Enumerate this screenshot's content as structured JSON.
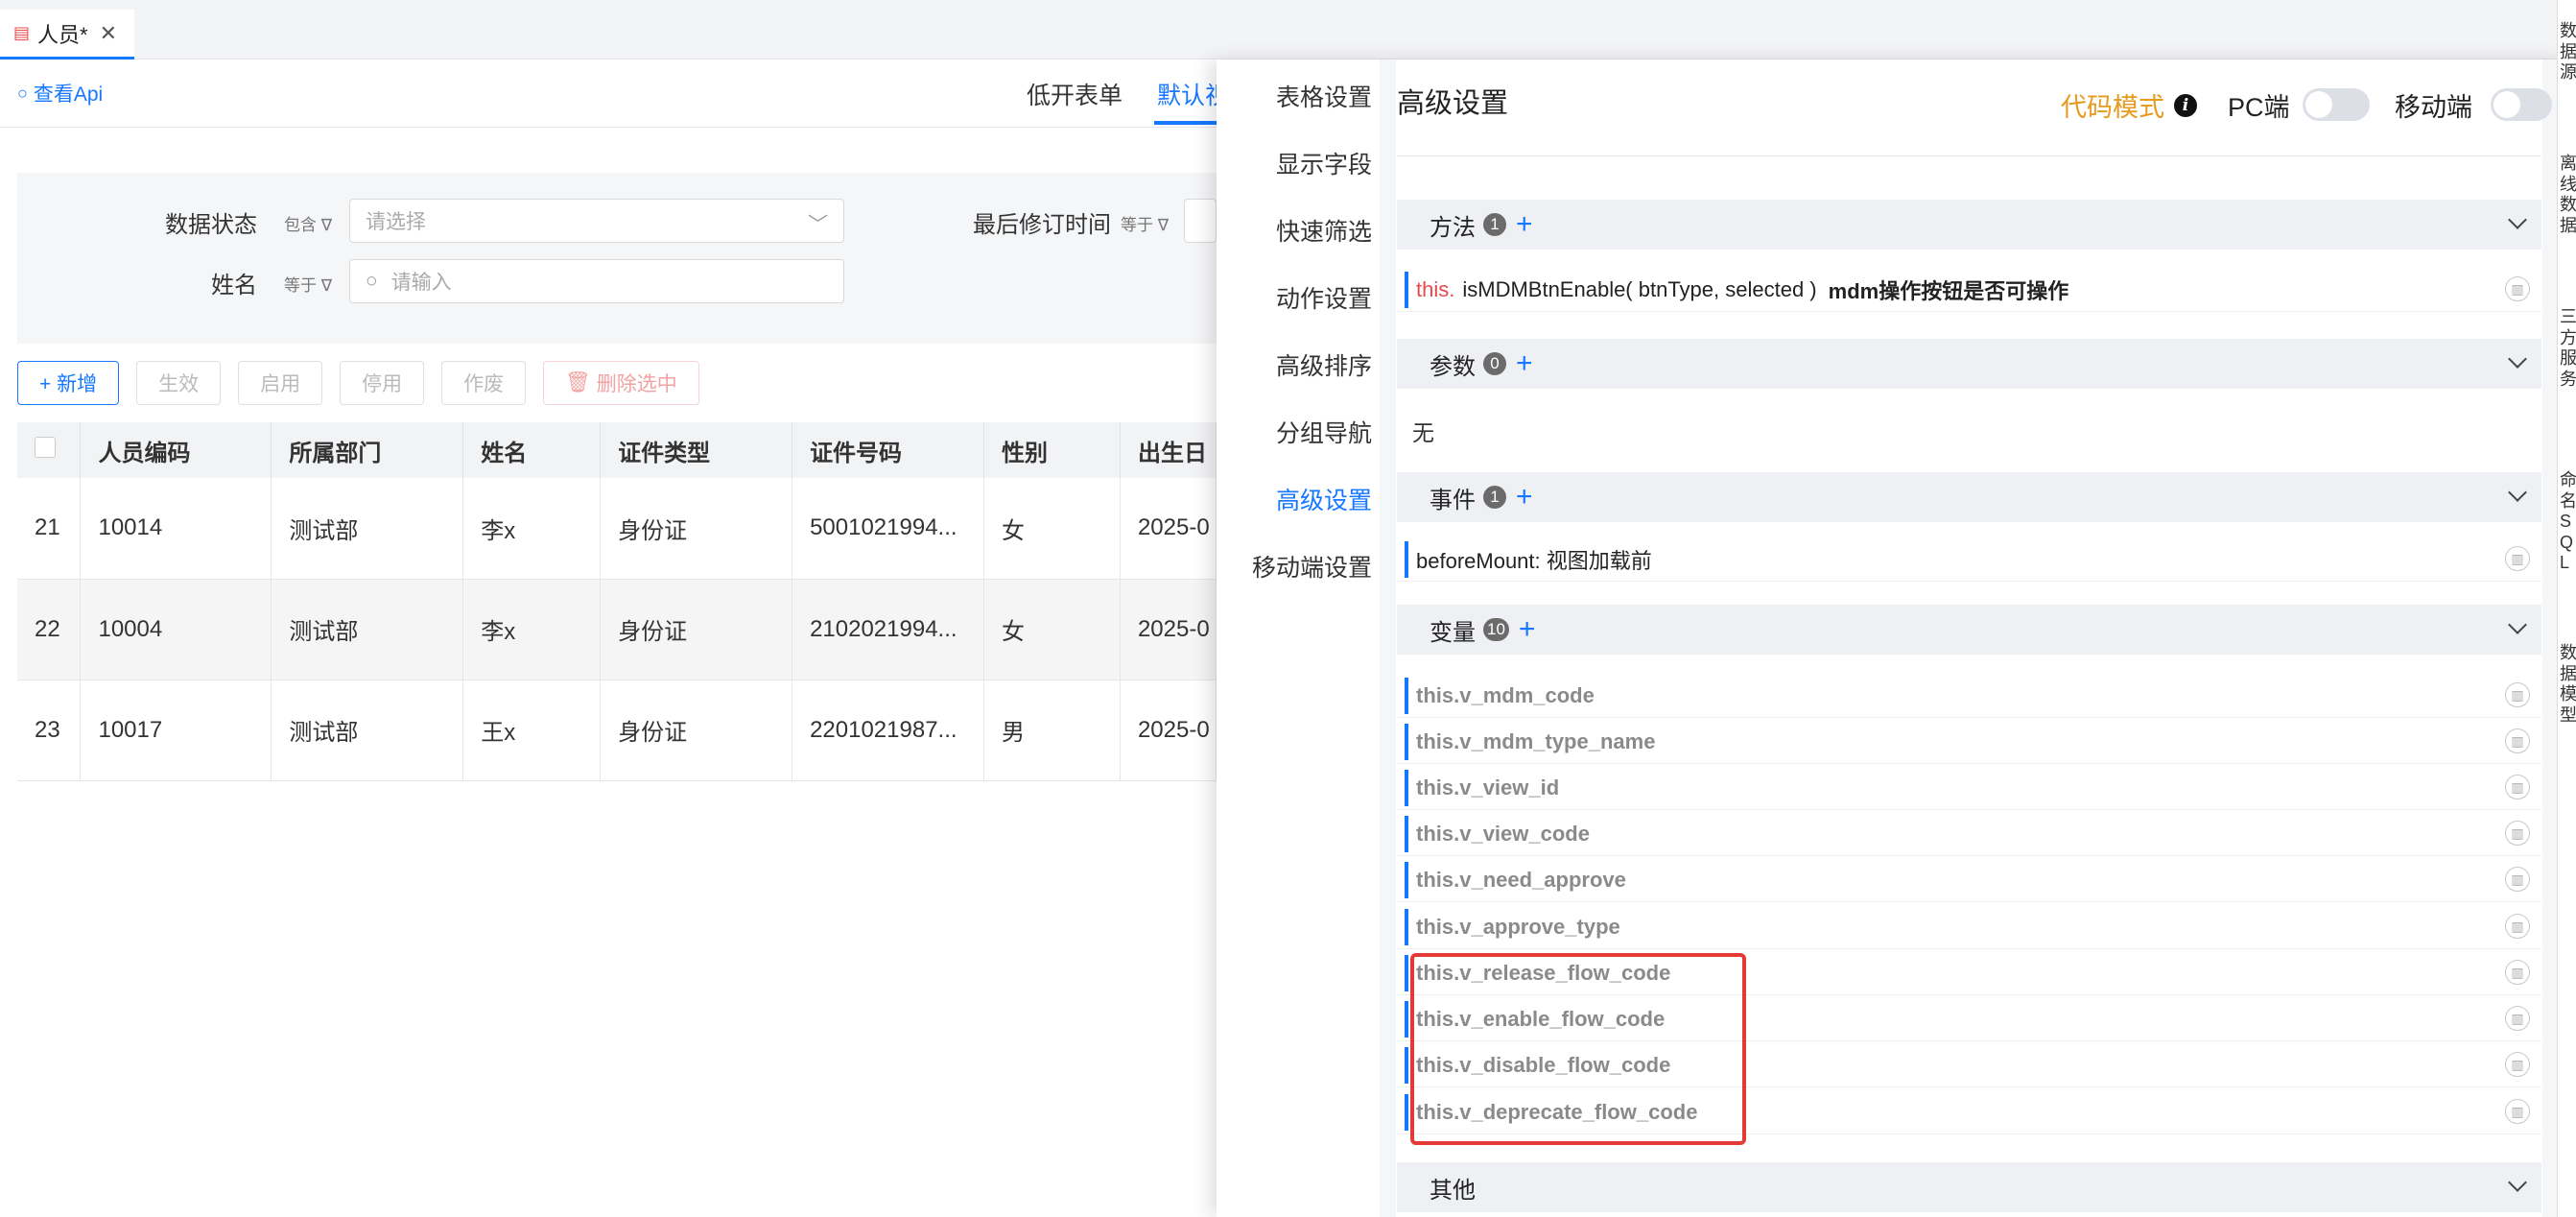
{
  "tab": {
    "title": "人员*",
    "doc_icon": "document-icon",
    "close_glyph": "✕"
  },
  "page": {
    "api_link": "查看Api",
    "nav": [
      "低开表单",
      "默认视"
    ]
  },
  "filters": {
    "status_label": "数据状态",
    "status_op": "包含",
    "status_placeholder": "请选择",
    "revise_label": "最后修订时间",
    "revise_op": "等于",
    "name_label": "姓名",
    "name_op": "等于",
    "name_placeholder": "请输入"
  },
  "toolbar": {
    "add": "+ 新增",
    "effect": "生效",
    "enable": "启用",
    "disable": "停用",
    "void": "作废",
    "delete": "删除选中"
  },
  "table": {
    "headers": [
      "人员编码",
      "所属部门",
      "姓名",
      "证件类型",
      "证件号码",
      "性别",
      "出生日"
    ],
    "rows": [
      [
        "21",
        "10014",
        "测试部",
        "李x",
        "身份证",
        "5001021994...",
        "女",
        "2025-0"
      ],
      [
        "22",
        "10004",
        "测试部",
        "李x",
        "身份证",
        "2102021994...",
        "女",
        "2025-0"
      ],
      [
        "23",
        "10017",
        "测试部",
        "王x",
        "身份证",
        "2201021987...",
        "男",
        "2025-0"
      ]
    ]
  },
  "panel": {
    "menu": [
      "表格设置",
      "显示字段",
      "快速筛选",
      "动作设置",
      "高级排序",
      "分组导航",
      "高级设置",
      "移动端设置"
    ],
    "active_menu": "高级设置",
    "title": "高级设置",
    "code_mode": "代码模式",
    "pc_label": "PC端",
    "mobile_label": "移动端",
    "methods": {
      "label": "方法",
      "count": "1",
      "items": [
        {
          "kw": "this.",
          "sig": "isMDMBtnEnable( btnType, selected )",
          "desc": "mdm操作按钮是否可操作"
        }
      ]
    },
    "params": {
      "label": "参数",
      "count": "0",
      "empty": "无"
    },
    "events": {
      "label": "事件",
      "count": "1",
      "items": [
        "beforeMount: 视图加载前"
      ]
    },
    "variables": {
      "label": "变量",
      "count": "10",
      "items": [
        "this.v_mdm_code",
        "this.v_mdm_type_name",
        "this.v_view_id",
        "this.v_view_code",
        "this.v_need_approve",
        "this.v_approve_type",
        "this.v_release_flow_code",
        "this.v_enable_flow_code",
        "this.v_disable_flow_code",
        "this.v_deprecate_flow_code"
      ]
    },
    "other": {
      "label": "其他"
    }
  },
  "right_strip": [
    "数",
    "据",
    "源",
    "离",
    "线",
    "数",
    "据",
    "三",
    "方",
    "服",
    "务",
    "命",
    "名",
    "S",
    "Q",
    "L",
    "数",
    "据",
    "模",
    "型"
  ],
  "colors": {
    "accent": "#1677ff",
    "highlight": "#e53935",
    "code_mode": "#e69a1f"
  }
}
